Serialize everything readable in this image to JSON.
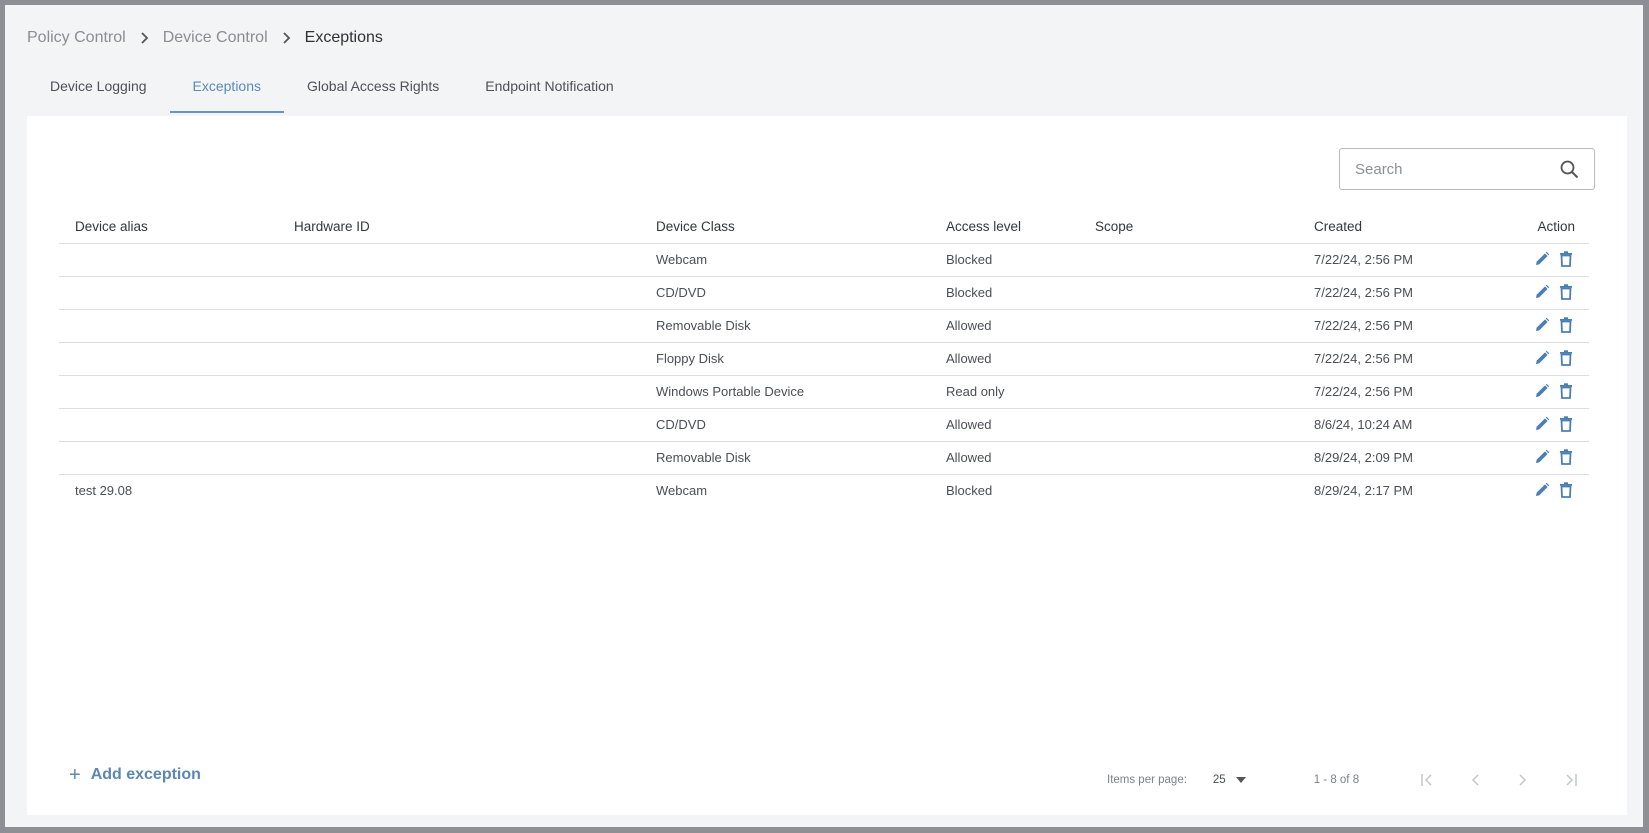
{
  "breadcrumb": {
    "items": [
      "Policy Control",
      "Device Control"
    ],
    "current": "Exceptions"
  },
  "tabs": [
    {
      "label": "Device Logging",
      "active": false
    },
    {
      "label": "Exceptions",
      "active": true
    },
    {
      "label": "Global Access Rights",
      "active": false
    },
    {
      "label": "Endpoint Notification",
      "active": false
    }
  ],
  "search": {
    "placeholder": "Search",
    "value": "",
    "icon": "search-icon"
  },
  "table": {
    "columns": [
      "Device alias",
      "Hardware ID",
      "Device Class",
      "Access level",
      "Scope",
      "Created",
      "Action"
    ],
    "rows": [
      {
        "alias": "",
        "hardware_id": "",
        "device_class": "Webcam",
        "access": "Blocked",
        "scope": "",
        "created": "7/22/24, 2:56 PM"
      },
      {
        "alias": "",
        "hardware_id": "",
        "device_class": "CD/DVD",
        "access": "Blocked",
        "scope": "",
        "created": "7/22/24, 2:56 PM"
      },
      {
        "alias": "",
        "hardware_id": "",
        "device_class": "Removable Disk",
        "access": "Allowed",
        "scope": "",
        "created": "7/22/24, 2:56 PM"
      },
      {
        "alias": "",
        "hardware_id": "",
        "device_class": "Floppy Disk",
        "access": "Allowed",
        "scope": "",
        "created": "7/22/24, 2:56 PM"
      },
      {
        "alias": "",
        "hardware_id": "",
        "device_class": "Windows Portable Device",
        "access": "Read only",
        "scope": "",
        "created": "7/22/24, 2:56 PM"
      },
      {
        "alias": "",
        "hardware_id": "",
        "device_class": "CD/DVD",
        "access": "Allowed",
        "scope": "",
        "created": "8/6/24, 10:24 AM"
      },
      {
        "alias": "",
        "hardware_id": "",
        "device_class": "Removable Disk",
        "access": "Allowed",
        "scope": "",
        "created": "8/29/24, 2:09 PM"
      },
      {
        "alias": "test 29.08",
        "hardware_id": "",
        "device_class": "Webcam",
        "access": "Blocked",
        "scope": "",
        "created": "8/29/24, 2:17 PM"
      }
    ],
    "row_actions": [
      "edit-icon",
      "delete-icon"
    ]
  },
  "footer": {
    "add_label": "Add exception",
    "add_icon": "+",
    "items_per_page_label": "Items per page:",
    "items_per_page": "25",
    "range_label": "1 - 8 of 8"
  },
  "colors": {
    "accent": "#5a8ab8",
    "icon_blue": "#4a7fb5",
    "background": "#f3f4f6",
    "frame": "#8e8e95"
  }
}
